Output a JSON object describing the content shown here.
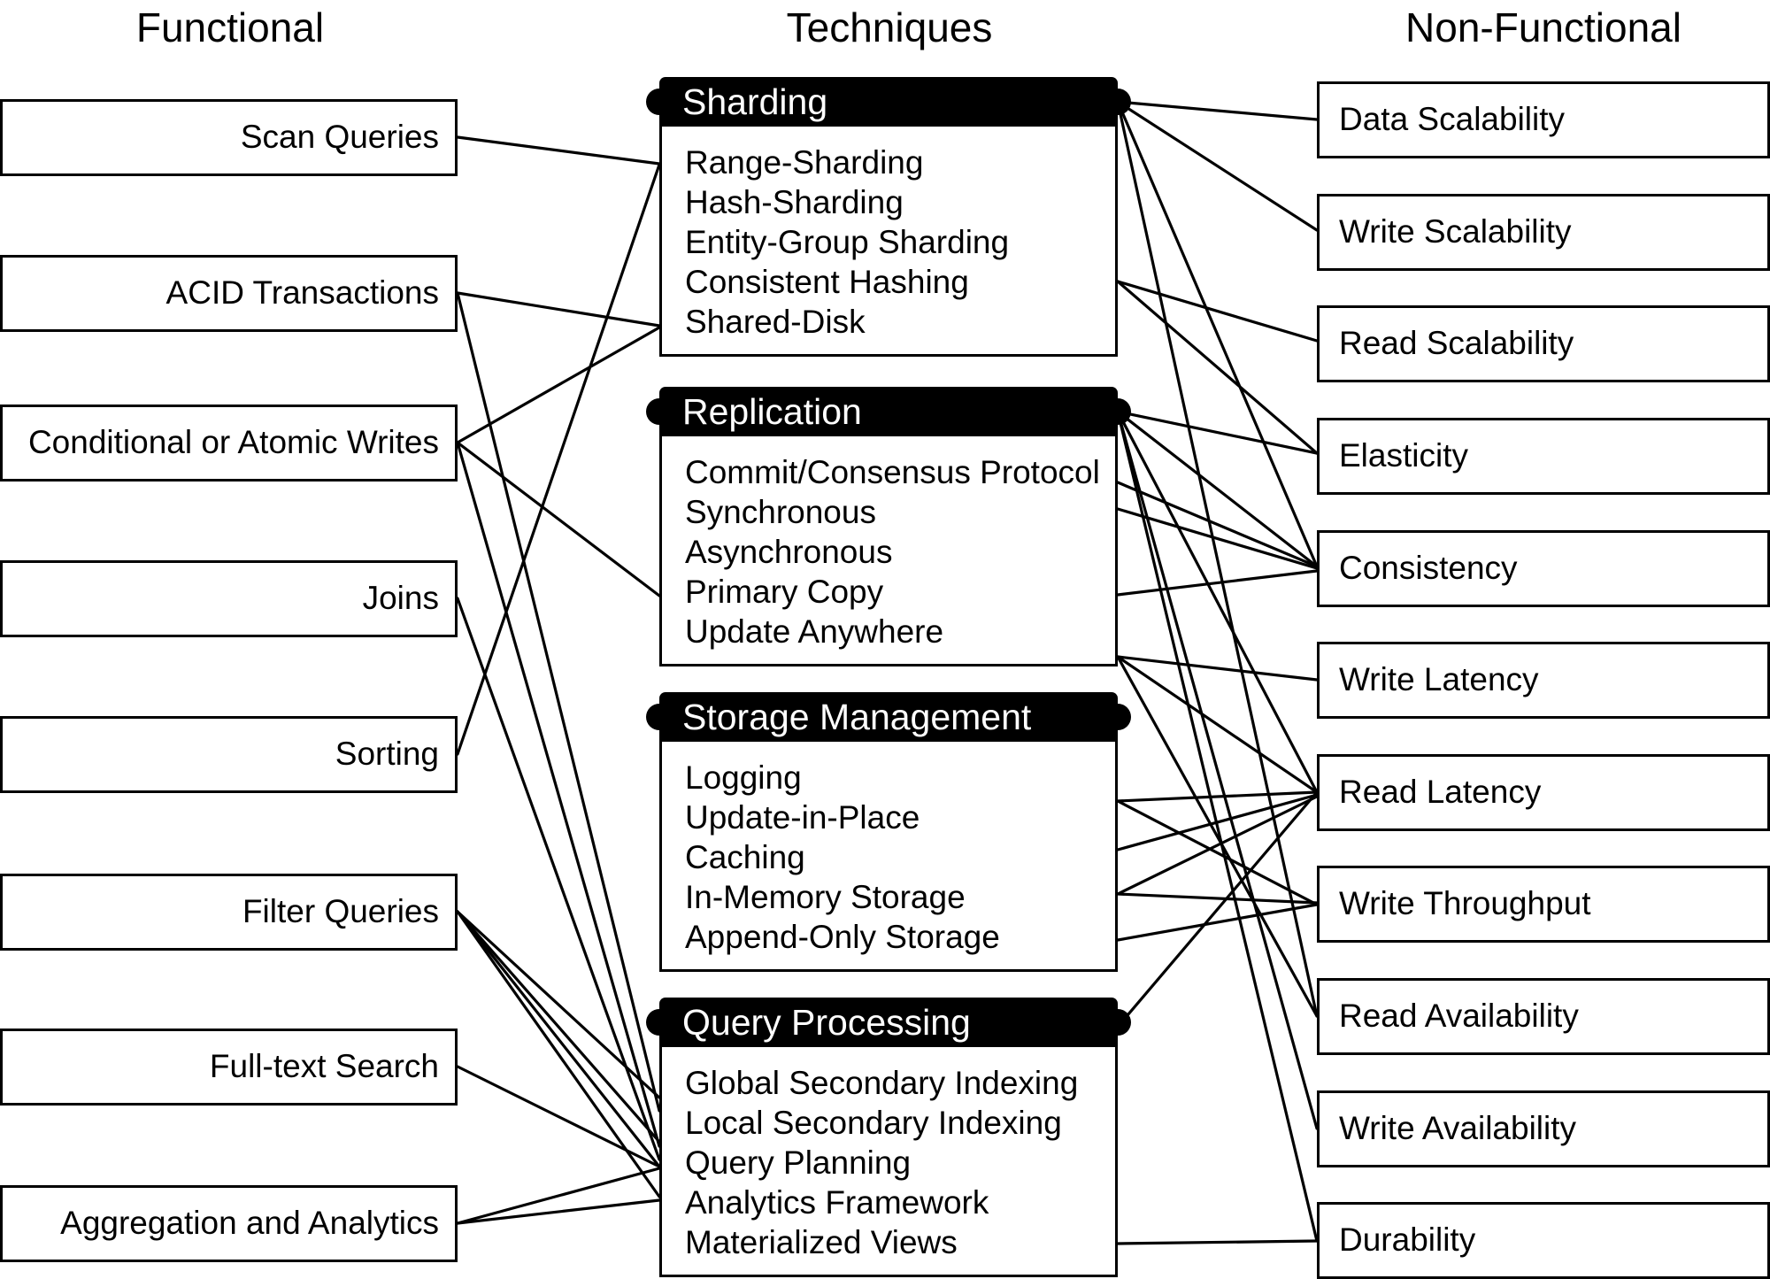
{
  "columns": {
    "functional": {
      "title": "Functional"
    },
    "techniques": {
      "title": "Techniques"
    },
    "nonfunctional": {
      "title": "Non-Functional"
    }
  },
  "functional_requirements": [
    {
      "id": "scan",
      "label": "Scan Queries"
    },
    {
      "id": "acid",
      "label": "ACID Transactions"
    },
    {
      "id": "cond",
      "label": "Conditional or Atomic Writes"
    },
    {
      "id": "joins",
      "label": "Joins"
    },
    {
      "id": "sort",
      "label": "Sorting"
    },
    {
      "id": "filter",
      "label": "Filter Queries"
    },
    {
      "id": "fts",
      "label": "Full-text Search"
    },
    {
      "id": "agg",
      "label": "Aggregation and Analytics"
    }
  ],
  "techniques": [
    {
      "id": "sharding",
      "title": "Sharding",
      "items": [
        "Range-Sharding",
        "Hash-Sharding",
        "Entity-Group Sharding",
        "Consistent Hashing",
        "Shared-Disk"
      ]
    },
    {
      "id": "replication",
      "title": "Replication",
      "items": [
        "Commit/Consensus Protocol",
        "Synchronous",
        "Asynchronous",
        "Primary Copy",
        "Update Anywhere"
      ]
    },
    {
      "id": "storage",
      "title": "Storage Management",
      "items": [
        "Logging",
        "Update-in-Place",
        "Caching",
        "In-Memory Storage",
        "Append-Only Storage"
      ]
    },
    {
      "id": "query",
      "title": "Query Processing",
      "items": [
        "Global Secondary Indexing",
        "Local Secondary Indexing",
        "Query Planning",
        "Analytics Framework",
        "Materialized Views"
      ]
    }
  ],
  "nonfunctional_requirements": [
    {
      "id": "datascal",
      "label": "Data Scalability"
    },
    {
      "id": "writescal",
      "label": "Write Scalability"
    },
    {
      "id": "readscal",
      "label": "Read Scalability"
    },
    {
      "id": "elastic",
      "label": "Elasticity"
    },
    {
      "id": "consist",
      "label": "Consistency"
    },
    {
      "id": "wlat",
      "label": "Write Latency"
    },
    {
      "id": "rlat",
      "label": "Read Latency"
    },
    {
      "id": "wtput",
      "label": "Write Throughput"
    },
    {
      "id": "ravail",
      "label": "Read Availability"
    },
    {
      "id": "wavail",
      "label": "Write Availability"
    },
    {
      "id": "durab",
      "label": "Durability"
    }
  ],
  "style": {
    "line_color": "#000000",
    "header_fill": "#000000",
    "header_text": "#ffffff",
    "box_fill": "#ffffff",
    "box_border": "#000000"
  }
}
